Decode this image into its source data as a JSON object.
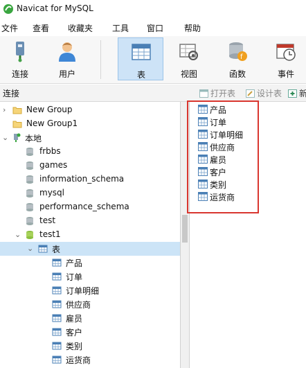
{
  "window": {
    "title": "Navicat for MySQL"
  },
  "menu": [
    "文件",
    "查看",
    "收藏夹",
    "工具",
    "窗口",
    "帮助"
  ],
  "toolbar": {
    "left": [
      {
        "label": "连接",
        "icon": "connection-icon"
      },
      {
        "label": "用户",
        "icon": "user-icon"
      }
    ],
    "right": [
      {
        "label": "表",
        "icon": "table-icon",
        "active": true
      },
      {
        "label": "视图",
        "icon": "view-icon"
      },
      {
        "label": "函数",
        "icon": "function-icon"
      },
      {
        "label": "事件",
        "icon": "event-icon"
      }
    ]
  },
  "subbar": {
    "connection_label": "连接",
    "open_table": "打开表",
    "design_table": "设计表",
    "new_table": "新"
  },
  "tree": {
    "group1": "New Group",
    "group2": "New Group1",
    "local": "本地",
    "databases": [
      "frbbs",
      "games",
      "information_schema",
      "mysql",
      "performance_schema",
      "test",
      "test1"
    ],
    "tables_node": "表",
    "tables": [
      "产品",
      "订单",
      "订单明细",
      "供应商",
      "雇员",
      "客户",
      "类别",
      "运货商"
    ]
  },
  "right_panel": {
    "tables": [
      "产品",
      "订单",
      "订单明细",
      "供应商",
      "雇员",
      "客户",
      "类别",
      "运货商"
    ]
  },
  "colors": {
    "selected": "#cce4f7",
    "highlight_box": "#d9362f",
    "active_button": "#cde3f7"
  }
}
